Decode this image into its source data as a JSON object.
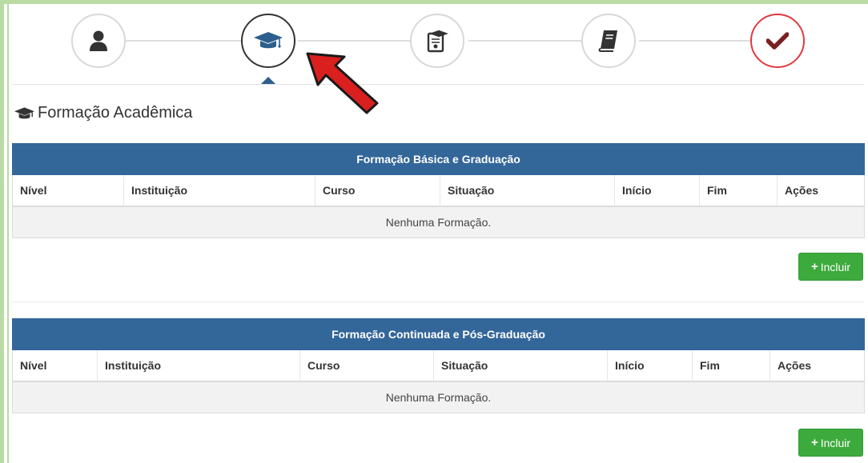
{
  "stepper": {
    "steps": [
      {
        "icon": "user-icon",
        "state": "done"
      },
      {
        "icon": "graduation-cap-icon",
        "state": "active"
      },
      {
        "icon": "certificate-icon",
        "state": "pending"
      },
      {
        "icon": "book-icon",
        "state": "pending"
      },
      {
        "icon": "check-icon",
        "state": "finish"
      }
    ]
  },
  "section": {
    "title": "Formação Acadêmica",
    "icon": "graduation-cap-icon"
  },
  "table1": {
    "caption": "Formação Básica e Graduação",
    "columns": [
      "Nível",
      "Instituição",
      "Curso",
      "Situação",
      "Início",
      "Fim",
      "Ações"
    ],
    "empty_message": "Nenhuma Formação.",
    "add_button": "Incluir"
  },
  "table2": {
    "caption": "Formação Continuada e Pós-Graduação",
    "columns": [
      "Nível",
      "Instituição",
      "Curso",
      "Situação",
      "Início",
      "Fim",
      "Ações"
    ],
    "empty_message": "Nenhuma Formação.",
    "add_button": "Incluir"
  },
  "colors": {
    "header": "#336699",
    "button": "#3daa3d",
    "frame": "#b9dba4",
    "arrow": "#d9201f",
    "finish": "#e03a3e",
    "check": "#7a1f1f"
  }
}
